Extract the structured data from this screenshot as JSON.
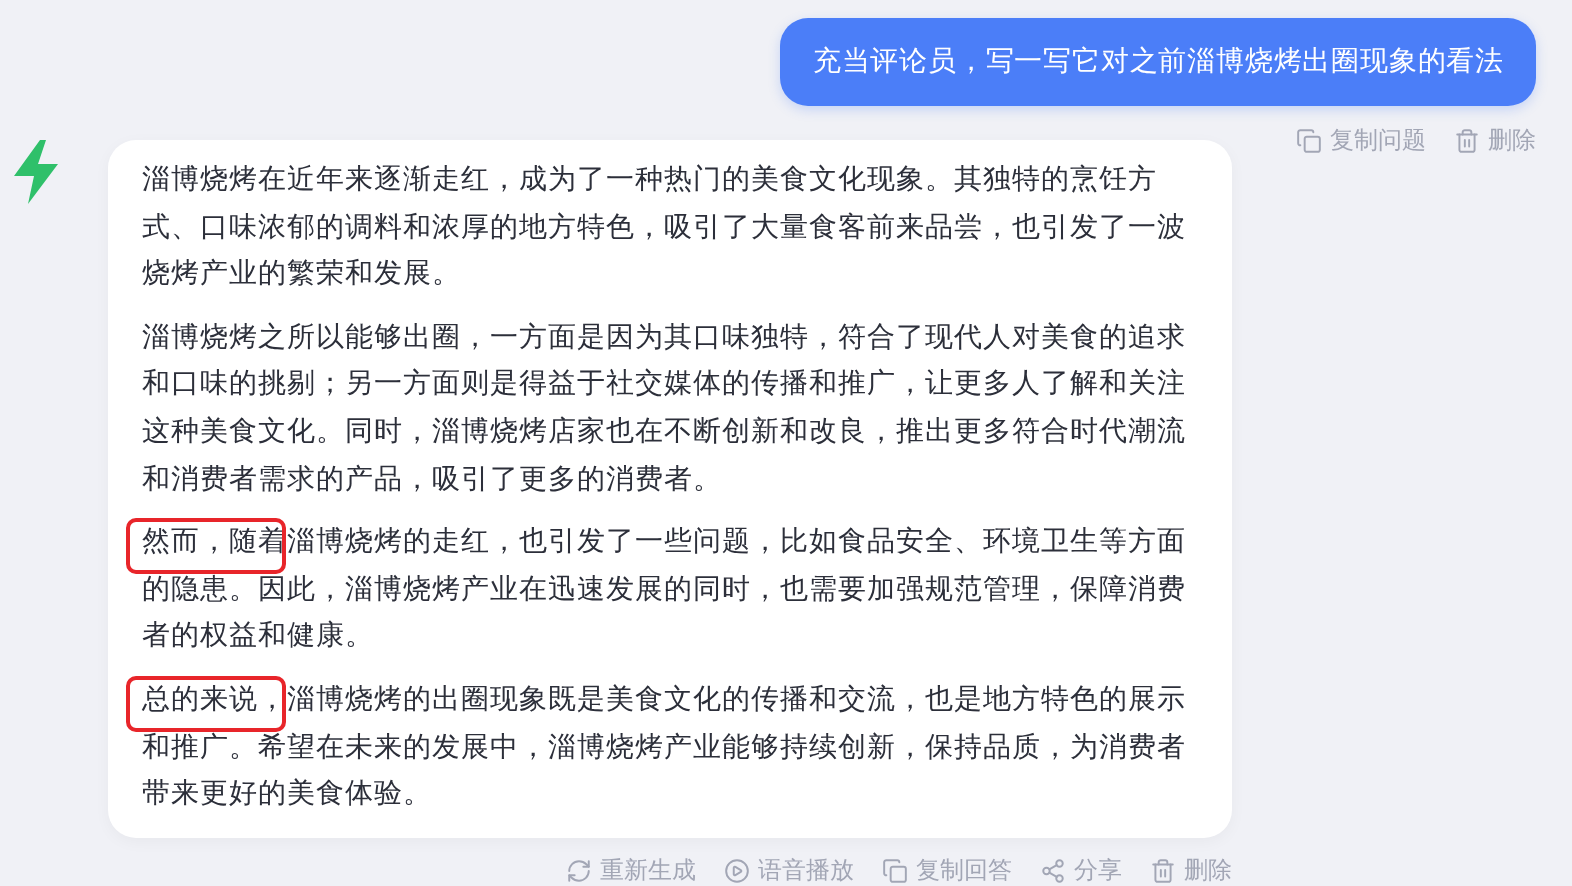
{
  "question": {
    "text": "充当评论员，写一写它对之前淄博烧烤出圈现象的看法",
    "actions": [
      {
        "kind": "copy",
        "label": "复制问题"
      },
      {
        "kind": "delete",
        "label": "删除"
      }
    ]
  },
  "answer": {
    "paragraphs": [
      {
        "text": "淄博烧烤在近年来逐渐走红，成为了一种热门的美食文化现象。其独特的烹饪方式、口味浓郁的调料和浓厚的地方特色，吸引了大量食客前来品尝，也引发了一波烧烤产业的繁荣和发展。",
        "highlighted": false
      },
      {
        "text": "淄博烧烤之所以能够出圈，一方面是因为其口味独特，符合了现代人对美食的追求和口味的挑剔；另一方面则是得益于社交媒体的传播和推广，让更多人了解和关注这种美食文化。同时，淄博烧烤店家也在不断创新和改良，推出更多符合时代潮流和消费者需求的产品，吸引了更多的消费者。",
        "highlighted": false
      },
      {
        "text": "然而，随着淄博烧烤的走红，也引发了一些问题，比如食品安全、环境卫生等方面的隐患。因此，淄博烧烤产业在迅速发展的同时，也需要加强规范管理，保障消费者的权益和健康。",
        "highlighted": true
      },
      {
        "text": "总的来说，淄博烧烤的出圈现象既是美食文化的传播和交流，也是地方特色的展示和推广。希望在未来的发展中，淄博烧烤产业能够持续创新，保持品质，为消费者带来更好的美食体验。",
        "highlighted": true
      }
    ],
    "actions": [
      {
        "kind": "regenerate",
        "label": "重新生成"
      },
      {
        "kind": "play",
        "label": "语音播放"
      },
      {
        "kind": "copy",
        "label": "复制回答"
      },
      {
        "kind": "share",
        "label": "分享"
      },
      {
        "kind": "delete",
        "label": "删除"
      }
    ]
  }
}
